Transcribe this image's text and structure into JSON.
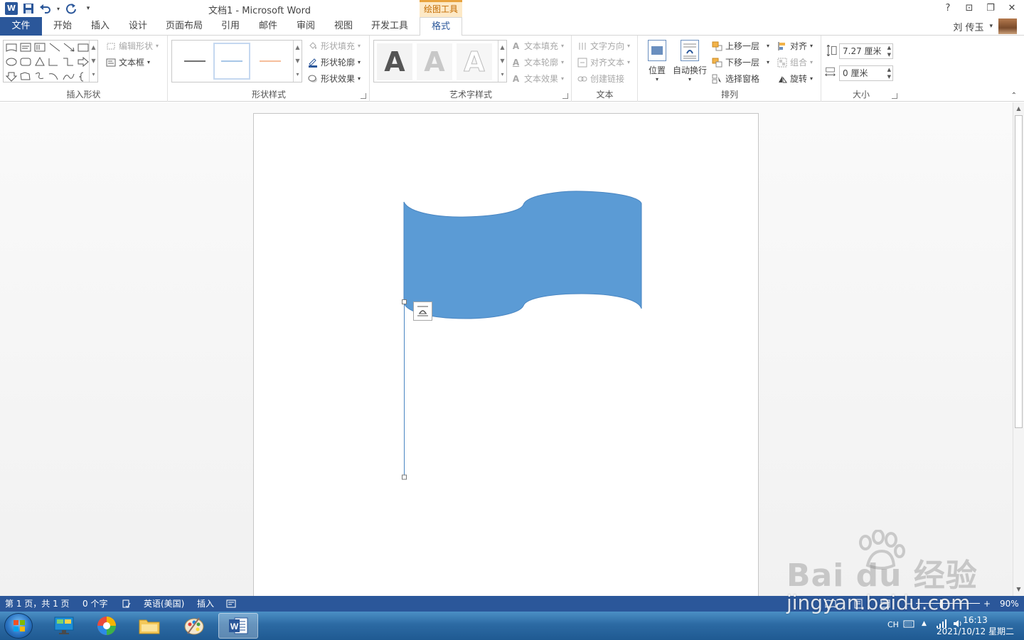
{
  "window": {
    "title": "文档1 - Microsoft Word",
    "context_tab": "绘图工具",
    "help": "?",
    "ribbon_display": "⊡",
    "restore": "❐",
    "close": "✕"
  },
  "qat": {
    "more": "▾"
  },
  "tabs": {
    "file": "文件",
    "items": [
      "开始",
      "插入",
      "设计",
      "页面布局",
      "引用",
      "邮件",
      "审阅",
      "视图",
      "开发工具",
      "格式"
    ],
    "active": "格式"
  },
  "user": {
    "name": "刘 传玉",
    "caret": "▾"
  },
  "ribbon": {
    "insert_shapes": {
      "label": "插入形状",
      "edit_shape": "编辑形状",
      "text_box": "文本框"
    },
    "shape_styles": {
      "label": "形状样式",
      "fill": "形状填充",
      "outline": "形状轮廓",
      "effects": "形状效果"
    },
    "wordart": {
      "label": "艺术字样式",
      "letter": "A",
      "text_fill": "文本填充",
      "text_outline": "文本轮廓",
      "text_effects": "文本效果"
    },
    "text": {
      "label": "文本",
      "direction": "文字方向",
      "align_text": "对齐文本",
      "create_link": "创建链接"
    },
    "arrange": {
      "label": "排列",
      "position": "位置",
      "wrap": "自动换行",
      "bring_forward": "上移一层",
      "send_backward": "下移一层",
      "selection_pane": "选择窗格",
      "align": "对齐",
      "group": "组合",
      "rotate": "旋转"
    },
    "size": {
      "label": "大小",
      "height": "7.27 厘米",
      "width": "0 厘米"
    }
  },
  "statusbar": {
    "page": "第 1 页，共 1 页",
    "words": "0 个字",
    "language": "英语(美国)",
    "mode": "插入",
    "zoom": "90%"
  },
  "taskbar": {
    "ime": "CH",
    "time": "16:13",
    "date": "2021/10/12 星期二"
  },
  "watermark": {
    "line1": "Bai du 经验",
    "line2": "jingyan.baidu.com"
  },
  "colors": {
    "accent": "#2b579a",
    "flag_fill": "#5b9bd5",
    "context_orange": "#e8a33d"
  }
}
